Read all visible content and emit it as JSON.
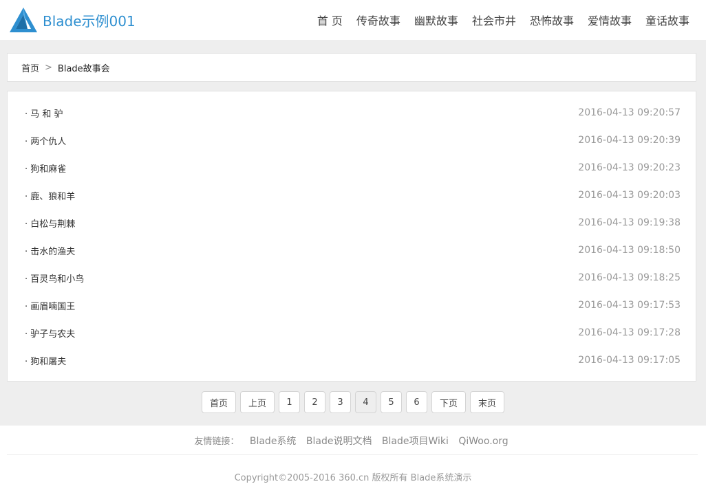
{
  "brand": {
    "name": "Blade示例001",
    "logo_icon": "triangle-logo-icon"
  },
  "colors": {
    "accent": "#2e8fd0",
    "background": "#eeeeee"
  },
  "nav": [
    "首 页",
    "传奇故事",
    "幽默故事",
    "社会市井",
    "恐怖故事",
    "爱情故事",
    "童话故事"
  ],
  "breadcrumb": {
    "home": "首页",
    "separator": ">",
    "current": "Blade故事会"
  },
  "articles": [
    {
      "title": "· 马 和 驴",
      "date": "2016-04-13 09:20:57"
    },
    {
      "title": "· 两个仇人",
      "date": "2016-04-13 09:20:39"
    },
    {
      "title": "· 狗和麻雀",
      "date": "2016-04-13 09:20:23"
    },
    {
      "title": "· 鹿、狼和羊",
      "date": "2016-04-13 09:20:03"
    },
    {
      "title": "· 白松与荆棘",
      "date": "2016-04-13 09:19:38"
    },
    {
      "title": "· 击水的渔夫",
      "date": "2016-04-13 09:18:50"
    },
    {
      "title": "· 百灵鸟和小鸟",
      "date": "2016-04-13 09:18:25"
    },
    {
      "title": "· 画眉喃国王",
      "date": "2016-04-13 09:17:53"
    },
    {
      "title": "· 驴子与农夫",
      "date": "2016-04-13 09:17:28"
    },
    {
      "title": "· 狗和屠夫",
      "date": "2016-04-13 09:17:05"
    }
  ],
  "pagination": {
    "first": "首页",
    "prev": "上页",
    "pages": [
      "1",
      "2",
      "3",
      "4",
      "5",
      "6"
    ],
    "current": "4",
    "next": "下页",
    "last": "末页"
  },
  "footer": {
    "links_label": "友情链接：",
    "links": [
      "Blade系统",
      "Blade说明文档",
      "Blade项目Wiki",
      "QiWoo.org"
    ],
    "copyright": "Copyright©2005-2016 360.cn 版权所有 Blade系统演示"
  }
}
